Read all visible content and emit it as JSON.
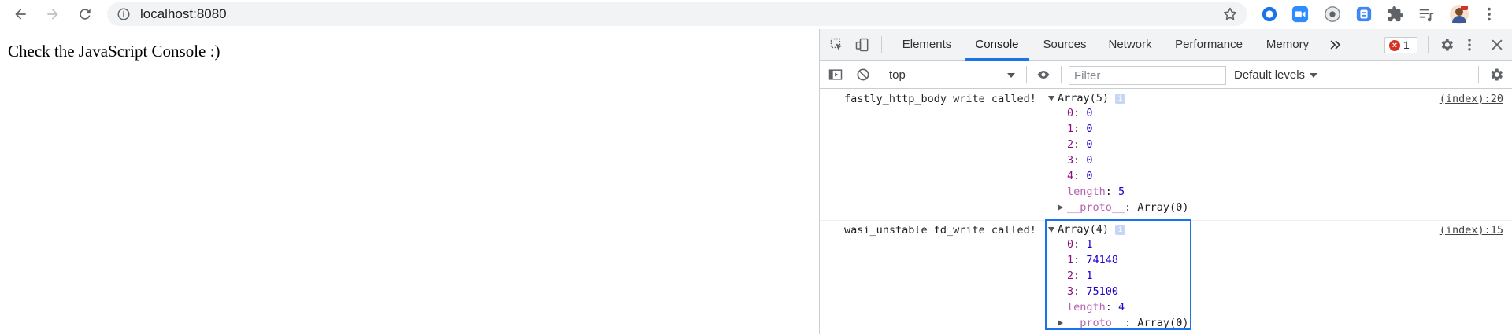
{
  "browser": {
    "url": "localhost:8080",
    "extensions": [
      "circle-o-icon",
      "video-icon",
      "chrome-icon",
      "puzzle-badge-icon",
      "puzzle-icon",
      "playlist-icon",
      "avatar-icon"
    ]
  },
  "page": {
    "text": "Check the JavaScript Console :)"
  },
  "devtools": {
    "tabs": [
      "Elements",
      "Console",
      "Sources",
      "Network",
      "Performance",
      "Memory"
    ],
    "active_tab": "Console",
    "error_count": "1",
    "context": "top",
    "filter_placeholder": "Filter",
    "levels": "Default levels"
  },
  "console": {
    "messages": [
      {
        "text": "fastly_http_body write called!",
        "source": "(index):20",
        "array_label": "Array(5)",
        "items": [
          {
            "key": "0",
            "value": "0"
          },
          {
            "key": "1",
            "value": "0"
          },
          {
            "key": "2",
            "value": "0"
          },
          {
            "key": "3",
            "value": "0"
          },
          {
            "key": "4",
            "value": "0"
          }
        ],
        "length_key": "length",
        "length_value": "5",
        "proto_key": "__proto__",
        "proto_value": "Array(0)"
      },
      {
        "text": "wasi_unstable fd_write called!",
        "source": "(index):15",
        "array_label": "Array(4)",
        "items": [
          {
            "key": "0",
            "value": "1"
          },
          {
            "key": "1",
            "value": "74148"
          },
          {
            "key": "2",
            "value": "1"
          },
          {
            "key": "3",
            "value": "75100"
          }
        ],
        "length_key": "length",
        "length_value": "4",
        "proto_key": "__proto__",
        "proto_value": "Array(0)"
      }
    ],
    "info_badge": "i"
  },
  "colors": {
    "accent": "#1a73e8",
    "error": "#d93025",
    "object_key": "#881280",
    "object_value": "#1c00cf"
  }
}
